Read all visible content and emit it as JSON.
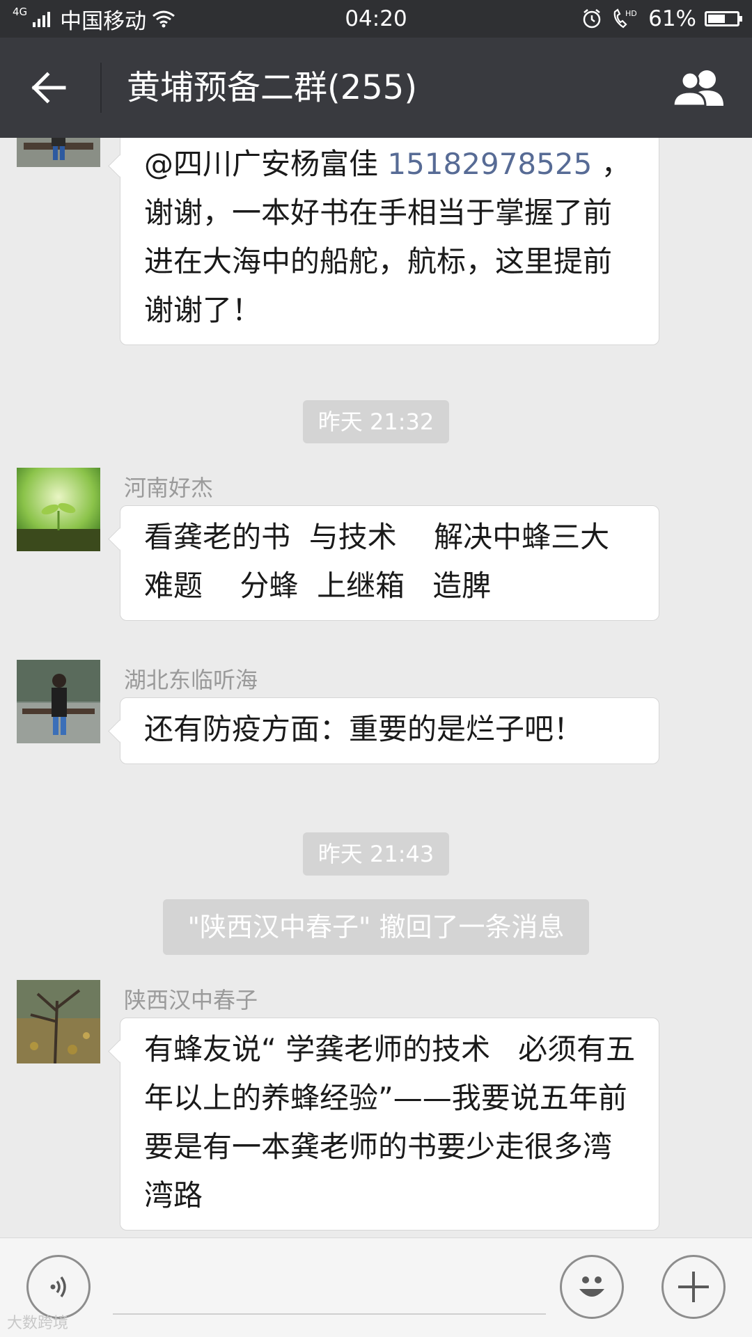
{
  "status_bar": {
    "network_type": "4G",
    "carrier": "中国移动",
    "time": "04:20",
    "hd_label": "HD",
    "battery_percent": "61%",
    "battery_level": 0.61
  },
  "header": {
    "title": "黄埔预备二群(255)"
  },
  "messages": [
    {
      "mention": "@四川广安杨富佳 ",
      "phone": "15182978525",
      "text": " ，\n谢谢，一本好书在手相当于掌握了前进在大海中的船舵，航标，这里提前谢谢了！"
    },
    {
      "timestamp": "昨天 21:32"
    },
    {
      "sender": "河南好杰",
      "text": "看龚老的书  与技术    解决中蜂三大难题    分蜂  上继箱   造脾"
    },
    {
      "sender": "湖北东临听海",
      "text": "还有防疫方面：重要的是烂子吧！"
    },
    {
      "timestamp": "昨天 21:43"
    },
    {
      "system": "\"陕西汉中春子\" 撤回了一条消息"
    },
    {
      "sender": "陕西汉中春子",
      "text": "有蜂友说“ 学龚老师的技术   必须有五年以上的养蜂经验”——我要说五年前要是有一本龚老师的书要少走很多湾湾路"
    }
  ],
  "input_bar": {
    "placeholder": "",
    "voice_icon": "voice-icon",
    "emoji_icon": "emoji-icon",
    "plus_icon": "plus-icon"
  },
  "watermark": "大数跨境"
}
